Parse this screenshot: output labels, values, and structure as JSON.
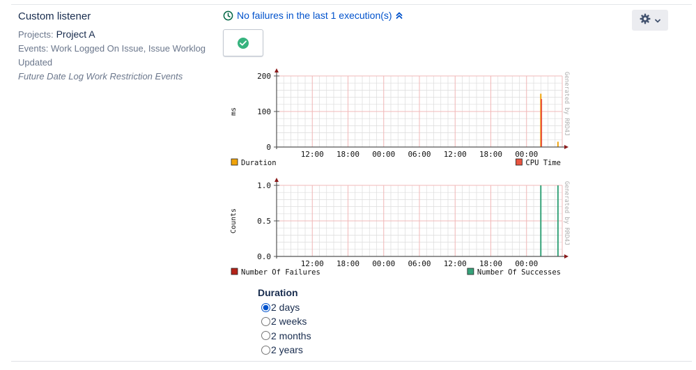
{
  "listener": {
    "title": "Custom listener",
    "projects_label": "Projects:",
    "projects_value": "Project A",
    "events_line1": "Events: Work Logged On Issue, Issue Worklog",
    "events_line2": "Updated",
    "description": "Future Date Log Work Restriction Events"
  },
  "status": {
    "text": "No failures in the last 1 execution(s)",
    "icon": "clock-icon",
    "toggle_icon": "double-chevron-up-icon",
    "color": "#0052cc"
  },
  "execution": {
    "result_icon": "check-circle-icon",
    "color": "#36b37e"
  },
  "actions": {
    "icon": "gear-icon",
    "dropdown_icon": "chevron-down-icon"
  },
  "chart_data": [
    {
      "type": "line",
      "ylabel": "ms",
      "yticks": [
        "0",
        "100",
        "200"
      ],
      "ylim": [
        0,
        200
      ],
      "xticks": [
        "12:00",
        "18:00",
        "00:00",
        "06:00",
        "12:00",
        "18:00",
        "00:00"
      ],
      "watermark": "Generated by RRD4J",
      "grid": true,
      "series": [
        {
          "name": "Duration",
          "color": "#f0a30a",
          "spikes": [
            {
              "x": 0.925,
              "y": 150
            },
            {
              "x": 0.985,
              "y": 15
            }
          ]
        },
        {
          "name": "CPU Time",
          "color": "#e8543f",
          "spikes": [
            {
              "x": 0.927,
              "y": 135
            }
          ]
        }
      ]
    },
    {
      "type": "line",
      "ylabel": "Counts",
      "yticks": [
        "0.0",
        "0.5",
        "1.0"
      ],
      "ylim": [
        0,
        1
      ],
      "xticks": [
        "12:00",
        "18:00",
        "00:00",
        "06:00",
        "12:00",
        "18:00",
        "00:00"
      ],
      "watermark": "Generated by RRD4J",
      "grid": true,
      "series": [
        {
          "name": "Number Of Failures",
          "color": "#b42318",
          "spikes": []
        },
        {
          "name": "Number Of Successes",
          "color": "#36a37a",
          "spikes": [
            {
              "x": 0.925,
              "y": 1.0
            },
            {
              "x": 0.985,
              "y": 1.0
            }
          ]
        }
      ]
    }
  ],
  "duration": {
    "title": "Duration",
    "options": [
      "2 days",
      "2 weeks",
      "2 months",
      "2 years"
    ],
    "selected": "2 days"
  }
}
